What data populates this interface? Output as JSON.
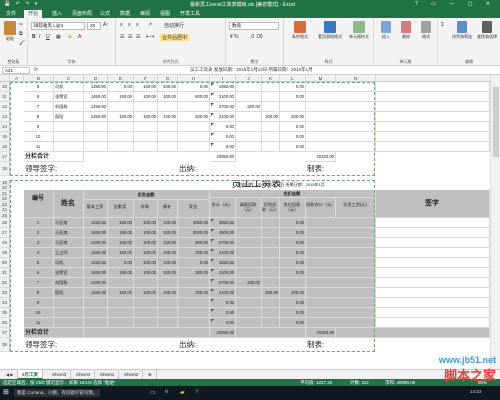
{
  "app": {
    "title": "最新员工excel工资表模板.xls [兼容模式] - Excel",
    "window_controls": "? ▭ — ▢ ✕",
    "quick_access": "💾 ↶ ↷ ▾"
  },
  "tabs": [
    "文件",
    "开始",
    "插入",
    "页面布局",
    "公式",
    "数据",
    "审阅",
    "视图",
    "开发工具"
  ],
  "active_tab": "开始",
  "ribbon": {
    "paste": "粘贴",
    "clipboard": "剪贴板",
    "font_name": "微软雅黑 Light",
    "font_size": "28",
    "font_group": "字体",
    "align_group": "对齐方式",
    "wrap_text": "自动换行",
    "merge_center": "合并后居中",
    "number_format": "数值",
    "number_group": "数字",
    "conditional": "条件格式",
    "table_format": "套用表格格式",
    "cell_styles": "单元格样式",
    "styles_group": "样式",
    "insert": "插入",
    "delete": "删除",
    "format": "格式",
    "cells_group": "单元格",
    "sort_filter": "排序和筛选",
    "find_select": "查找和选择",
    "edit_group": "编辑"
  },
  "formula_bar": {
    "name_box": "A21",
    "fx": "fx",
    "formula": "员工工资表    发放日期：2015年2月12日    所属日期：2015年1月"
  },
  "columns": [
    "A",
    "B",
    "C",
    "D",
    "E",
    "F",
    "G",
    "H",
    "I",
    "J",
    "K",
    "L",
    "M",
    "N"
  ],
  "upper_rows": [
    {
      "r": "10",
      "no": "5",
      "name": "司机",
      "v": [
        "1450.00",
        "0.00",
        "100.00",
        "100.00",
        "0.00",
        "1650.00",
        "",
        "",
        "0.00",
        "1650.00"
      ]
    },
    {
      "r": "11",
      "no": "6",
      "name": "张警官",
      "v": [
        "1450.00",
        "150.00",
        "100.00",
        "100.00",
        "800.00",
        "2100.00",
        "",
        "",
        "0.00",
        "2100.00"
      ]
    },
    {
      "r": "12",
      "no": "7",
      "name": "刘国栋",
      "v": [
        "1450.00",
        "",
        "",
        "",
        "",
        "2700.00",
        "330.00",
        "",
        "",
        "2370.00"
      ]
    },
    {
      "r": "13",
      "no": "8",
      "name": "邱阳",
      "v": [
        "1450.00",
        "150.00",
        "100.00",
        "100.00",
        "300.00",
        "2100.00",
        "",
        "200.00",
        "200.00",
        "1900.00"
      ]
    },
    {
      "r": "14",
      "no": "9",
      "name": "",
      "v": [
        "",
        "",
        "",
        "",
        "",
        "0.00",
        "",
        "",
        "0.00",
        "0.00"
      ]
    },
    {
      "r": "15",
      "no": "10",
      "name": "",
      "v": [
        "",
        "",
        "",
        "",
        "",
        "0.00",
        "",
        "",
        "0.00",
        "0.00"
      ]
    },
    {
      "r": "16",
      "no": "11",
      "name": "",
      "v": [
        "",
        "",
        "",
        "",
        "",
        "0.00",
        "",
        "",
        "0.00",
        "0.00"
      ]
    }
  ],
  "subtotal_upper": {
    "r": "17",
    "label": "分栏合计",
    "gross": "20850.00",
    "net": "20320.00"
  },
  "sign_upper": {
    "r": "18",
    "leader": "领导签字:",
    "cashier": "出纳:",
    "maker": "制表:"
  },
  "section2": {
    "big_title": "员工工资表",
    "date_tail": "发放日期：2015年2月12日 所属日期：2015年1月",
    "h_no": "编号",
    "h_name": "姓名",
    "h_should": "应发金额",
    "h_deduct": "应扣金额",
    "h_sign": "签字",
    "sub": [
      "基本工资",
      "全勤奖",
      "补助",
      "餐补",
      "奖金",
      "合计（元）",
      "请假扣款（元）",
      "迟到扣款（元）",
      "其它扣款（元）",
      "扣款合计（元）",
      "实发工资(元)"
    ]
  },
  "lower_rows": [
    {
      "r": "26",
      "no": "1",
      "name": "马亚南",
      "v": [
        "1450.00",
        "150.00",
        "100.00",
        "100.00",
        "3050.00",
        "3850.00",
        "",
        "",
        "0.00",
        "3850.00"
      ]
    },
    {
      "r": "27",
      "no": "2",
      "name": "马亚南",
      "v": [
        "1450.00",
        "150.00",
        "100.00",
        "100.00",
        "3000.00",
        "4800.00",
        "",
        "",
        "0.00",
        "4800.00"
      ]
    },
    {
      "r": "28",
      "no": "3",
      "name": "马亚南",
      "v": [
        "1450.00",
        "150.00",
        "100.00",
        "100.00",
        "900.00",
        "2700.00",
        "",
        "",
        "0.00",
        "2700.00"
      ]
    },
    {
      "r": "29",
      "no": "4",
      "name": "王立明",
      "v": [
        "1450.00",
        "150.00",
        "100.00",
        "100.00",
        "300.00",
        "2100.00",
        "",
        "",
        "0.00",
        "2100.00"
      ]
    },
    {
      "r": "30",
      "no": "5",
      "name": "司机",
      "v": [
        "1450.00",
        "0.00",
        "100.00",
        "100.00",
        "0.00",
        "1650.00",
        "",
        "",
        "0.00",
        "1650.00"
      ]
    },
    {
      "r": "31",
      "no": "6",
      "name": "张警官",
      "v": [
        "1450.00",
        "150.00",
        "100.00",
        "100.00",
        "300.00",
        "2100.00",
        "",
        "",
        "0.00",
        "2100.00"
      ]
    },
    {
      "r": "32",
      "no": "7",
      "name": "刘国栋",
      "v": [
        "1450.00",
        "",
        "",
        "",
        "",
        "2700.00",
        "330.00",
        "",
        "",
        "2370.00"
      ]
    },
    {
      "r": "33",
      "no": "8",
      "name": "邱阳",
      "v": [
        "1450.00",
        "150.00",
        "100.00",
        "100.00",
        "300.00",
        "2100.00",
        "",
        "200.00",
        "200.00",
        "1900.00"
      ]
    },
    {
      "r": "34",
      "no": "9",
      "name": "",
      "v": [
        "",
        "",
        "",
        "",
        "",
        "0.00",
        "",
        "",
        "0.00",
        "0.00"
      ]
    },
    {
      "r": "35",
      "no": "10",
      "name": "",
      "v": [
        "",
        "",
        "",
        "",
        "",
        "0.00",
        "",
        "",
        "0.00",
        "0.00"
      ]
    },
    {
      "r": "36",
      "no": "11",
      "name": "",
      "v": [
        "",
        "",
        "",
        "",
        "",
        "0.00",
        "",
        "",
        "0.00",
        "0.00"
      ]
    }
  ],
  "subtotal_lower": {
    "r": "37",
    "label": "分栏合计",
    "gross": "20850.00",
    "net": "20320.00"
  },
  "sign_lower": {
    "r": "38",
    "leader": "领导签字:",
    "cashier": "出纳:",
    "maker": "制表:"
  },
  "header_rows": [
    "19",
    "20",
    "21",
    "22",
    "23",
    "24",
    "25"
  ],
  "sheets": [
    "5月工资",
    "Sheet3",
    "Sheet4",
    "Sheet1",
    "Sheet2",
    "⊕"
  ],
  "active_sheet": "5月工资",
  "status": {
    "left": "选定区域后，按 Shift 键可显示... 如果 19/1/8 选择 \"粘贴\"",
    "avg": "平均值: 1227.25",
    "count": "计数: 112",
    "sum": "求和: 49090.00",
    "zoom": "90%"
  },
  "taskbar": {
    "search": "我是 Cortana，小娜。有问题尽管问我。",
    "time": "14:23"
  },
  "watermark": {
    "line1": "www.jb51.net",
    "line2": "脚本之家"
  },
  "colors": {
    "excel_green": "#217346",
    "select_green": "#6aa57f"
  }
}
